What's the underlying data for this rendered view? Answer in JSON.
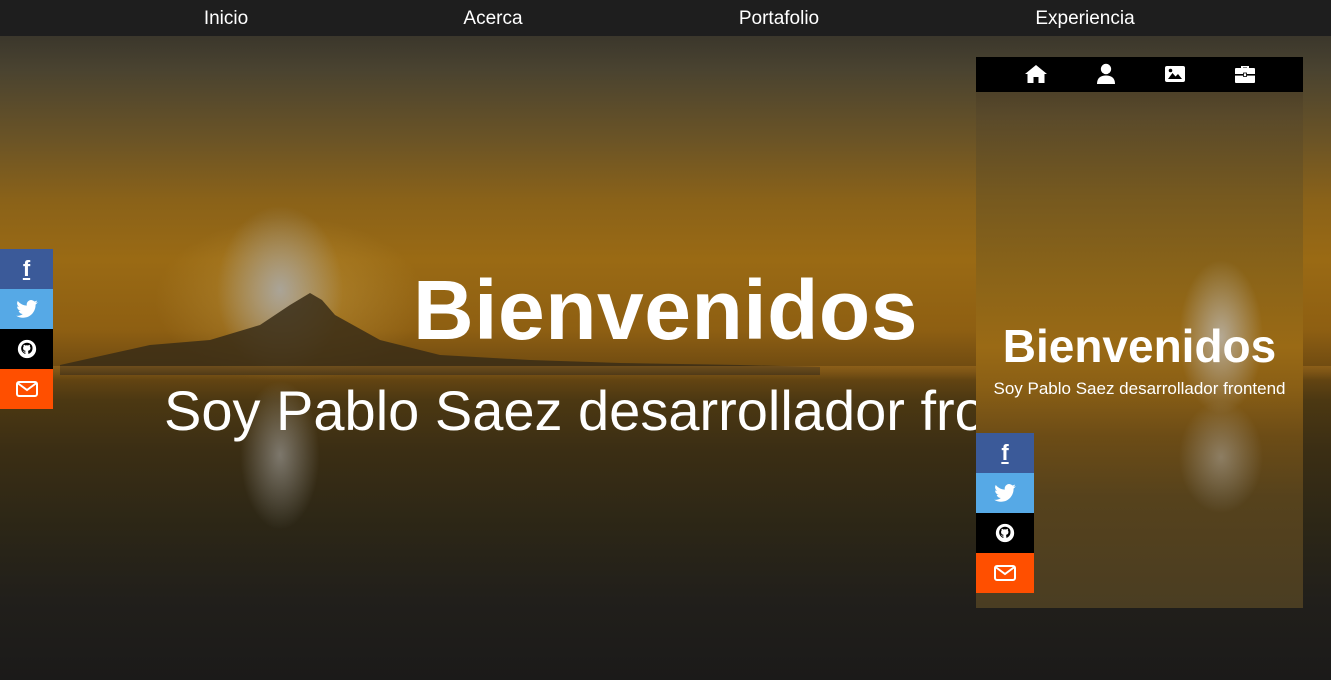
{
  "nav": {
    "items": [
      {
        "label": "Inicio"
      },
      {
        "label": "Acerca"
      },
      {
        "label": "Portafolio"
      },
      {
        "label": "Experiencia"
      }
    ]
  },
  "hero": {
    "title": "Bienvenidos",
    "subtitle": "Soy Pablo Saez desarrollador frontend"
  },
  "social": {
    "items": [
      {
        "icon": "facebook-icon",
        "glyph": "f",
        "color": "#3b5a99"
      },
      {
        "icon": "twitter-icon",
        "color": "#56a9e6"
      },
      {
        "icon": "github-icon",
        "color": "#000000"
      },
      {
        "icon": "mail-icon",
        "color": "#ff4f00"
      }
    ]
  },
  "mobile_preview": {
    "nav_icons": [
      "home-icon",
      "user-icon",
      "image-icon",
      "briefcase-icon"
    ],
    "title": "Bienvenidos",
    "subtitle": "Soy Pablo Saez desarrollador frontend"
  },
  "colors": {
    "nav_bg": "#1e1e1e",
    "mobile_nav_bg": "#000000",
    "text": "#ffffff"
  }
}
